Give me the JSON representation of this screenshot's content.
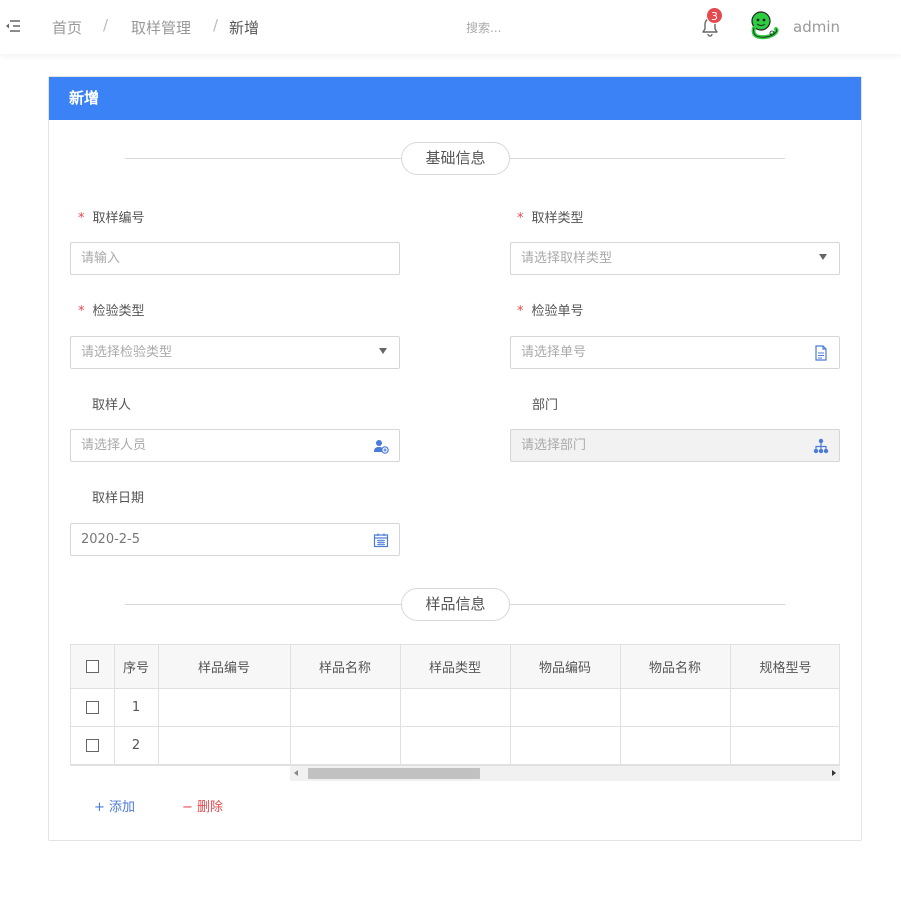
{
  "header": {
    "breadcrumbs": [
      "首页",
      "取样管理",
      "新增"
    ],
    "separator": "/",
    "search_placeholder": "搜索...",
    "notification_count": "3",
    "username": "admin"
  },
  "card": {
    "title": "新增",
    "section_basic": "基础信息",
    "section_sample": "样品信息"
  },
  "form": {
    "sample_no": {
      "label": "取样编号",
      "required": "*",
      "placeholder": "请输入"
    },
    "sample_type": {
      "label": "取样类型",
      "required": "*",
      "placeholder": "请选择取样类型"
    },
    "inspection_type": {
      "label": "检验类型",
      "required": "*",
      "placeholder": "请选择检验类型"
    },
    "inspection_no": {
      "label": "检验单号",
      "required": "*",
      "placeholder": "请选择单号"
    },
    "sampler": {
      "label": "取样人",
      "placeholder": "请选择人员"
    },
    "department": {
      "label": "部门",
      "placeholder": "请选择部门"
    },
    "sample_date": {
      "label": "取样日期",
      "value": "2020-2-5"
    }
  },
  "table": {
    "headers": [
      "序号",
      "样品编号",
      "样品名称",
      "样品类型",
      "物品编码",
      "物品名称",
      "规格型号"
    ],
    "rows": [
      {
        "index": "1"
      },
      {
        "index": "2"
      }
    ]
  },
  "actions": {
    "add": "+ 添加",
    "delete": "− 删除"
  },
  "colors": {
    "primary": "#3b82f6",
    "danger": "#e5484d",
    "icon_blue": "#4a7bd8",
    "avatar_green": "#2ecc40"
  }
}
